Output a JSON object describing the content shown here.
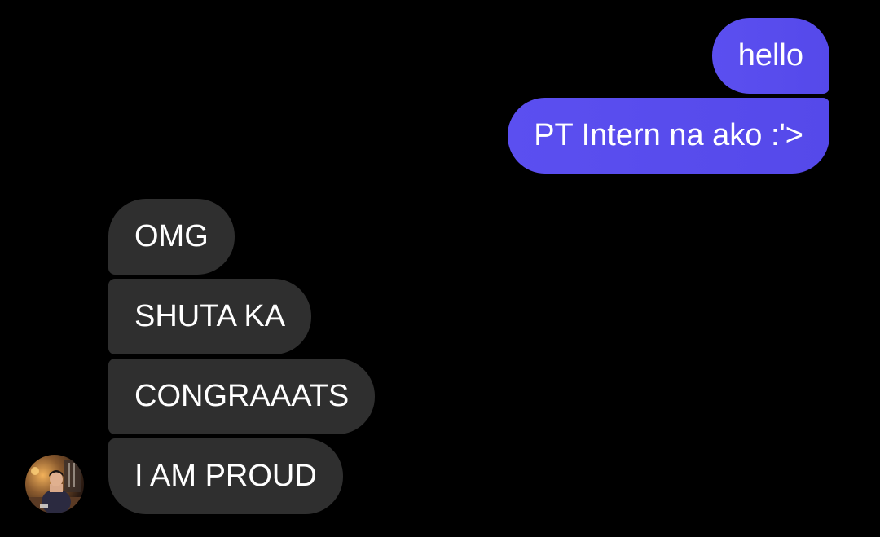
{
  "conversation": {
    "sent": [
      {
        "text": "hello"
      },
      {
        "text": "PT Intern na ako :'>"
      }
    ],
    "received": [
      {
        "text": "OMG"
      },
      {
        "text": "SHUTA KA"
      },
      {
        "text": "CONGRAAATS"
      },
      {
        "text": "I AM PROUD"
      }
    ],
    "contact_avatar": {
      "icon": "contact-avatar-photo"
    }
  },
  "colors": {
    "background": "#000000",
    "sent_bubble": "#5a4dee",
    "received_bubble": "#2f2f2f",
    "text": "#ffffff"
  }
}
